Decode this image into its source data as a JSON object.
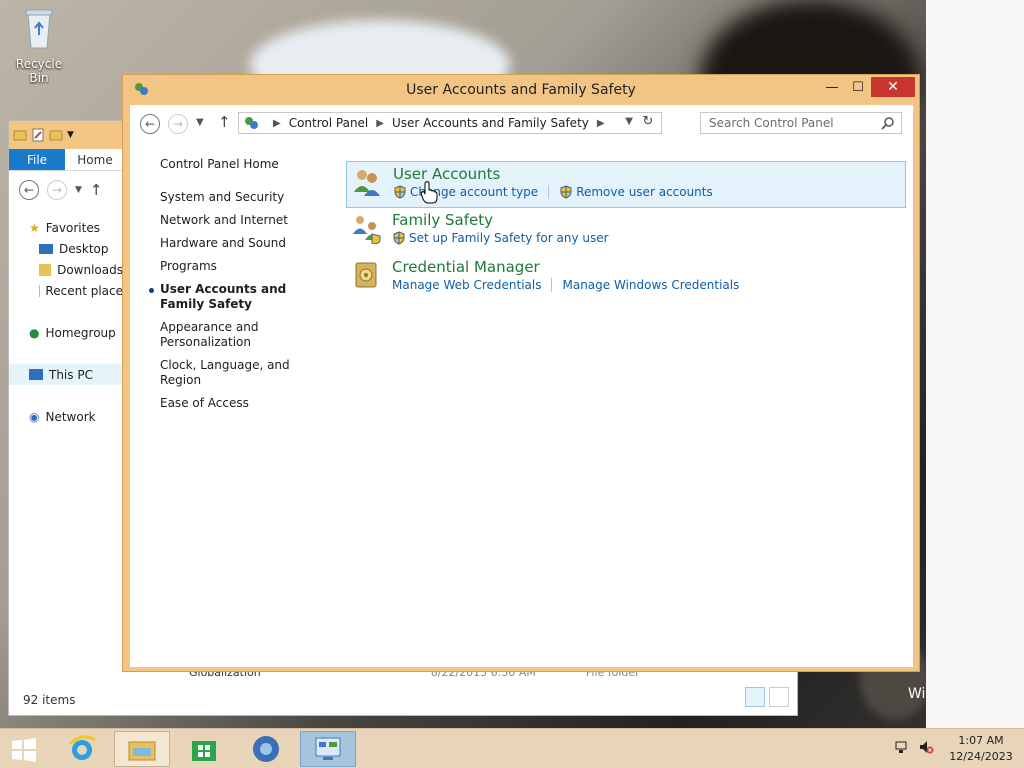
{
  "desktop": {
    "recycle_bin_label": "Recycle Bin",
    "watermark_text": "Wi"
  },
  "explorer": {
    "file_tab": "File",
    "home_tab": "Home",
    "tree": [
      "Favorites",
      "Desktop",
      "Downloads",
      "Recent place",
      "Homegroup",
      "This PC",
      "Network"
    ],
    "peek_row": {
      "name": "Globalization",
      "date": "8/22/2013 6:50 AM",
      "type": "File folder"
    },
    "status": "92 items"
  },
  "cp": {
    "title": "User Accounts and Family Safety",
    "address": {
      "crumbs": [
        "Control Panel",
        "User Accounts and Family Safety"
      ]
    },
    "search_placeholder": "Search Control Panel",
    "nav": {
      "home": "Control Panel Home",
      "items": [
        "System and Security",
        "Network and Internet",
        "Hardware and Sound",
        "Programs",
        "User Accounts and Family Safety",
        "Appearance and Personalization",
        "Clock, Language, and Region",
        "Ease of Access"
      ],
      "current_index": 4
    },
    "categories": [
      {
        "title": "User Accounts",
        "links": [
          "Change account type",
          "Remove user accounts"
        ],
        "shielded": [
          true,
          true
        ]
      },
      {
        "title": "Family Safety",
        "links": [
          "Set up Family Safety for any user"
        ],
        "shielded": [
          true
        ]
      },
      {
        "title": "Credential Manager",
        "links": [
          "Manage Web Credentials",
          "Manage Windows Credentials"
        ],
        "shielded": [
          false,
          false
        ]
      }
    ]
  },
  "taskbar": {
    "clock_time": "1:07 AM",
    "clock_date": "12/24/2023"
  },
  "colors": {
    "window_frame": "#f2c585",
    "close_button": "#c7372f",
    "category_title": "#1e7a3b",
    "link": "#0f5ea5",
    "taskbar": "#e8d4b8"
  }
}
